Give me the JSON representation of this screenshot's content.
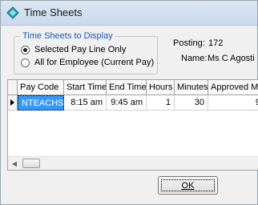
{
  "window": {
    "title": "Time Sheets"
  },
  "display_group": {
    "legend": "Time Sheets to Display",
    "options": [
      {
        "label": "Selected Pay Line Only",
        "checked": true
      },
      {
        "label": "All for Employee (Current Pay)",
        "checked": false
      }
    ]
  },
  "info": {
    "posting_label": "Posting:",
    "posting_value": "172",
    "name_label": "Name:",
    "name_value": "Ms C Agosti"
  },
  "grid": {
    "columns": [
      "Pay Code",
      "Start Time",
      "End Time",
      "Hours",
      "Minutes",
      "Approved Mi"
    ],
    "rows": [
      {
        "pay_code": "NTEACHS",
        "start_time": "8:15 am",
        "end_time": "9:45 am",
        "hours": "1",
        "minutes": "30",
        "approved_minutes": "9"
      }
    ]
  },
  "buttons": {
    "ok_label": "OK"
  },
  "icons": {
    "app": "diamond-app-icon",
    "scroll_left": "scroll-left-arrow-icon",
    "row_selector": "current-row-arrow-icon"
  }
}
